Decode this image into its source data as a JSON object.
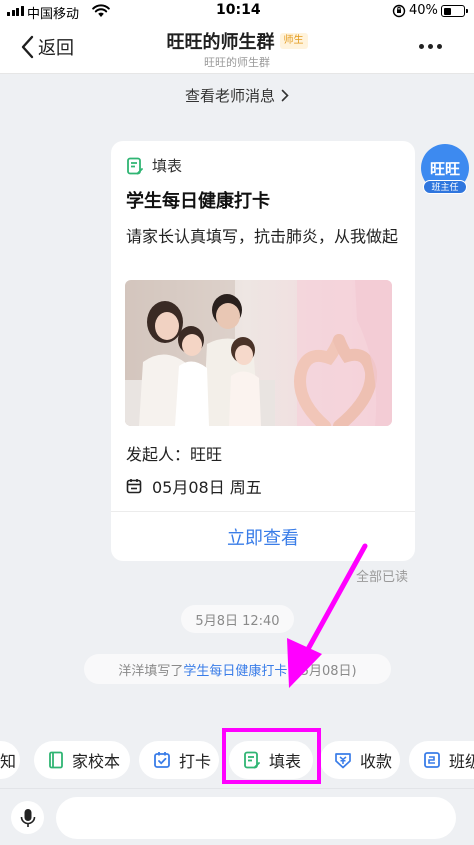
{
  "status_bar": {
    "carrier": "中国移动",
    "time": "10:14",
    "battery_percent": "40%",
    "battery_level": 0.4,
    "icons": [
      "signal-icon",
      "wifi-icon",
      "orientation-lock-icon",
      "battery-icon"
    ]
  },
  "nav": {
    "back_label": "返回",
    "title": "旺旺的师生群",
    "tag": "师生",
    "subtitle": "旺旺的师生群",
    "icons": [
      "chevron-left-icon",
      "more-icon"
    ]
  },
  "teacher_bar": {
    "label": "查看老师消息"
  },
  "message_card": {
    "type_label": "填表",
    "title": "学生每日健康打卡",
    "description": "请家长认真填写，抗击肺炎，从我做起",
    "sender": "发起人：旺旺",
    "date": "05月08日 周五",
    "action_label": "立即查看",
    "image": "family-heart-hands-photo"
  },
  "avatar": {
    "name": "旺旺",
    "badge": "班主任"
  },
  "read_status": "全部已读",
  "timestamp": "5月8日 12:40",
  "notice": {
    "prefix": "洋洋填写了",
    "link": "学生每日健康打卡",
    "suffix": "(05月08日)"
  },
  "tools": [
    {
      "label": "知",
      "icon": "notice-icon"
    },
    {
      "label": "家校本",
      "icon": "book-icon"
    },
    {
      "label": "打卡",
      "icon": "checkin-icon"
    },
    {
      "label": "填表",
      "icon": "form-icon"
    },
    {
      "label": "收款",
      "icon": "payment-icon"
    },
    {
      "label": "班级",
      "icon": "class-icon"
    }
  ],
  "annotation": {
    "highlight_color": "#ff00ff",
    "target": "填表"
  },
  "colors": {
    "accent": "#3a7de8",
    "background": "#eef0f3",
    "tag": "#e39a1c",
    "avatar": "#3d8af0",
    "form_icon": "#2fb573"
  }
}
